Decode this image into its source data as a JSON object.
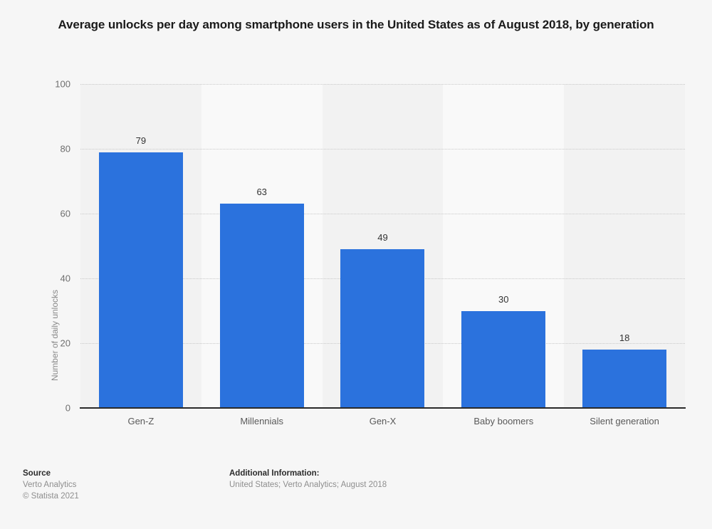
{
  "chart_data": {
    "type": "bar",
    "title": "Average unlocks per day among smartphone users in the United States as of August 2018, by generation",
    "xlabel": "",
    "ylabel": "Number of daily unlocks",
    "categories": [
      "Gen-Z",
      "Millennials",
      "Gen-X",
      "Baby boomers",
      "Silent generation"
    ],
    "values": [
      79,
      63,
      49,
      30,
      18
    ],
    "ylim": [
      0,
      100
    ],
    "yticks": [
      0,
      20,
      40,
      60,
      80,
      100
    ],
    "ytick_labels": [
      "0",
      "20",
      "40",
      "60",
      "80",
      "100"
    ],
    "value_labels": [
      "79",
      "63",
      "49",
      "30",
      "18"
    ],
    "grid": "horizontal-dotted",
    "legend": "none",
    "bar_color": "#2b72dd",
    "band_colors": [
      "#f2f2f2",
      "#f9f9f9"
    ],
    "background": "#f6f6f6"
  },
  "footer": {
    "source_heading": "Source",
    "source_name": "Verto Analytics",
    "copyright": "© Statista 2021",
    "additional_heading": "Additional Information:",
    "additional_text": "United States; Verto Analytics; August 2018"
  }
}
